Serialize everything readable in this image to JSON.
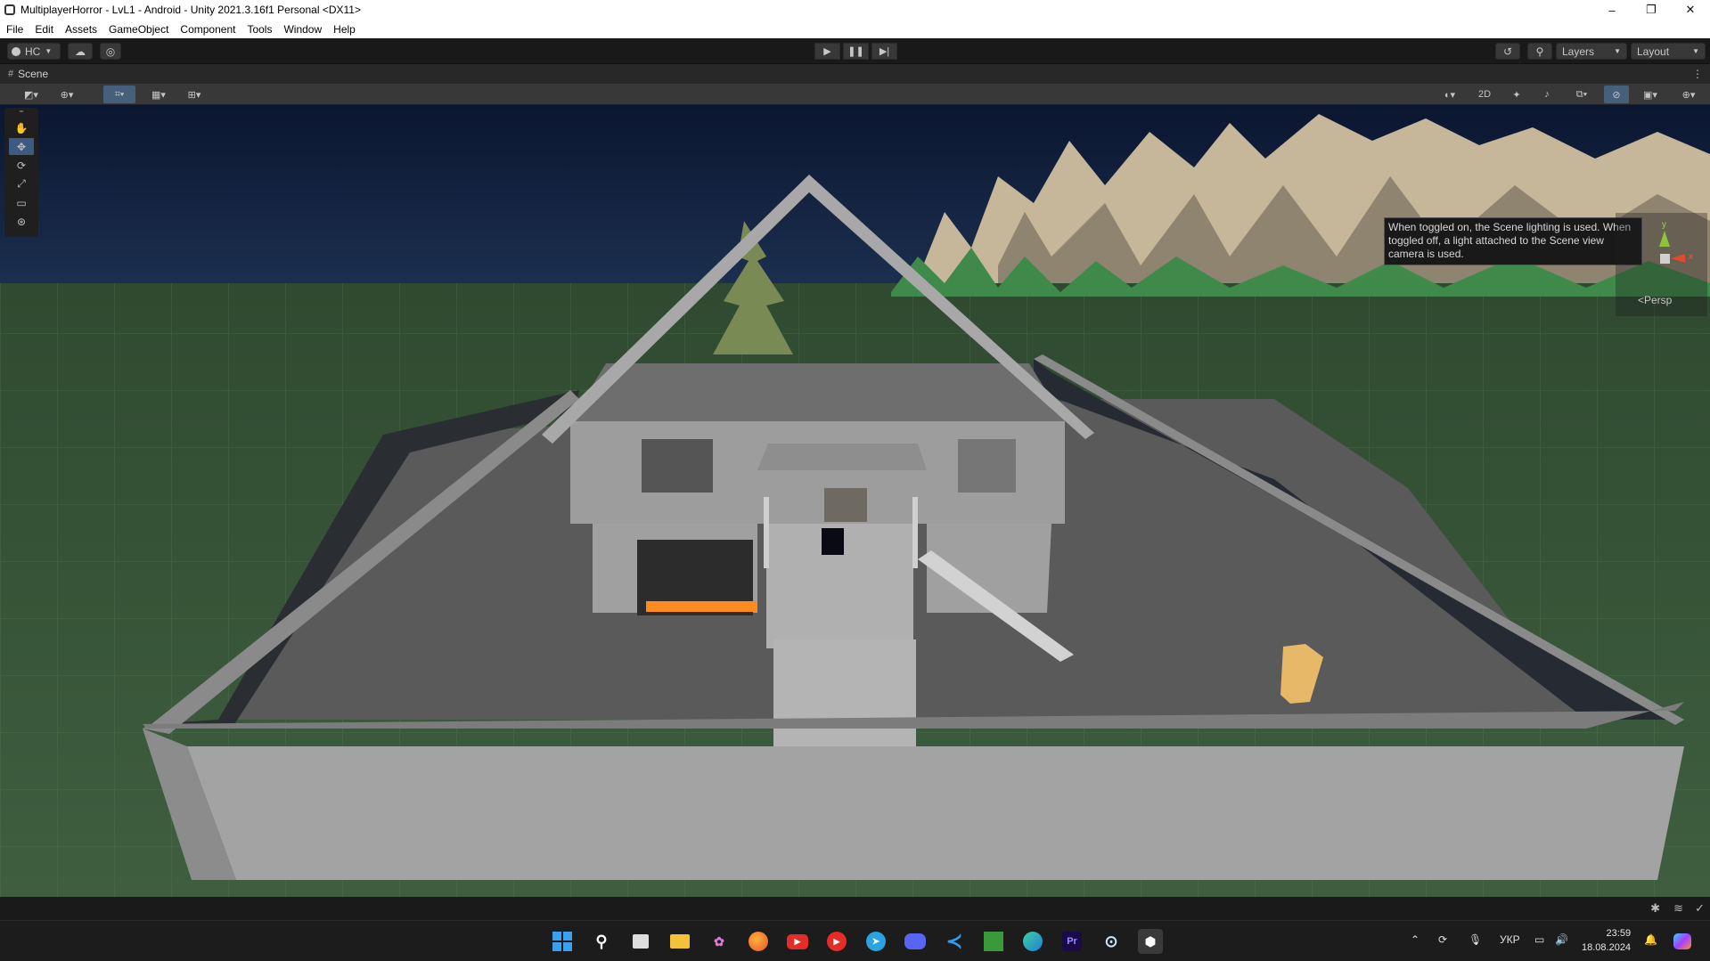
{
  "window": {
    "title": "MultiplayerHorror - LvL1 - Android - Unity 2021.3.16f1 Personal <DX11>",
    "controls": [
      "–",
      "❐",
      "✕"
    ]
  },
  "menu": [
    "File",
    "Edit",
    "Assets",
    "GameObject",
    "Component",
    "Tools",
    "Window",
    "Help"
  ],
  "toolbar": {
    "account_label": "HC",
    "layers_label": "Layers",
    "layout_label": "Layout"
  },
  "scene_tab": {
    "label": "Scene"
  },
  "scene_toolbar": {
    "mode_2d": "2D"
  },
  "viewport": {
    "tooltip": "When toggled on, the Scene lighting is used. When toggled off, a light attached to the Scene view camera is used.",
    "gizmo": {
      "y": "y",
      "x": "x",
      "persp": "<Persp"
    }
  },
  "taskbar": {
    "lang": "УКР",
    "time": "23:59",
    "date": "18.08.2024",
    "apps": [
      "start-icon",
      "search-icon",
      "task-view-icon",
      "file-explorer-icon",
      "photos-icon",
      "firefox-icon",
      "youtube-icon",
      "youtube-music-icon",
      "telegram-icon",
      "discord-icon",
      "vscode-icon",
      "minecraft-icon",
      "browser-icon",
      "premiere-pro-icon",
      "steam-icon",
      "unity-icon"
    ],
    "premiere_label": "Pr"
  },
  "colors": {
    "accent": "#3d5b80",
    "sky_top": "#0c1830",
    "ground": "#3a5a3a",
    "building": "#a8a8a8",
    "orange": "#ff8a20"
  }
}
